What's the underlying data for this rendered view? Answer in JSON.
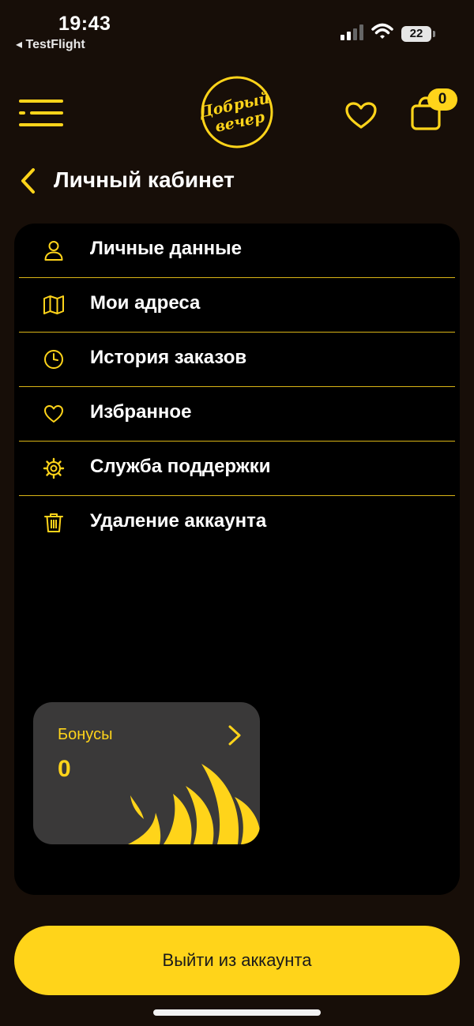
{
  "status_bar": {
    "time": "19:43",
    "back_app": "◂ TestFlight",
    "battery": "22"
  },
  "header": {
    "logo_text": "Добрый вечер",
    "cart_count": "0"
  },
  "page": {
    "title": "Личный кабинет"
  },
  "menu": {
    "items": [
      {
        "label": "Личные данные",
        "icon": "user-icon"
      },
      {
        "label": "Мои адреса",
        "icon": "map-icon"
      },
      {
        "label": "История заказов",
        "icon": "clock-icon"
      },
      {
        "label": "Избранное",
        "icon": "heart-icon"
      },
      {
        "label": "Служба поддержки",
        "icon": "gear-icon"
      },
      {
        "label": "Удаление аккаунта",
        "icon": "trash-icon"
      }
    ]
  },
  "bonus": {
    "title": "Бонусы",
    "value": "0"
  },
  "logout": {
    "label": "Выйти из аккаунта"
  },
  "colors": {
    "accent": "#FFD41A",
    "background": "#170e08",
    "panel": "#000000",
    "card": "#3a3939"
  }
}
